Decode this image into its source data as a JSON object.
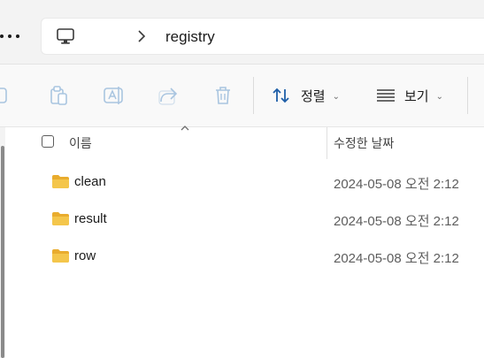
{
  "address": {
    "path_label": "registry"
  },
  "toolbar": {
    "sort_label": "정렬",
    "view_label": "보기"
  },
  "columns": {
    "name": "이름",
    "date_modified": "수정한 날짜"
  },
  "files": [
    {
      "name": "clean",
      "date": "2024-05-08 오전 2:12",
      "type_icon": "folder-icon"
    },
    {
      "name": "result",
      "date": "2024-05-08 오전 2:12",
      "type_icon": "folder-icon"
    },
    {
      "name": "row",
      "date": "2024-05-08 오전 2:12",
      "type_icon": "folder-icon"
    }
  ],
  "colors": {
    "folder": "#f4c64b",
    "toolbar_disabled": "#a9c5e0",
    "sort_icon": "#1f5fa8"
  }
}
